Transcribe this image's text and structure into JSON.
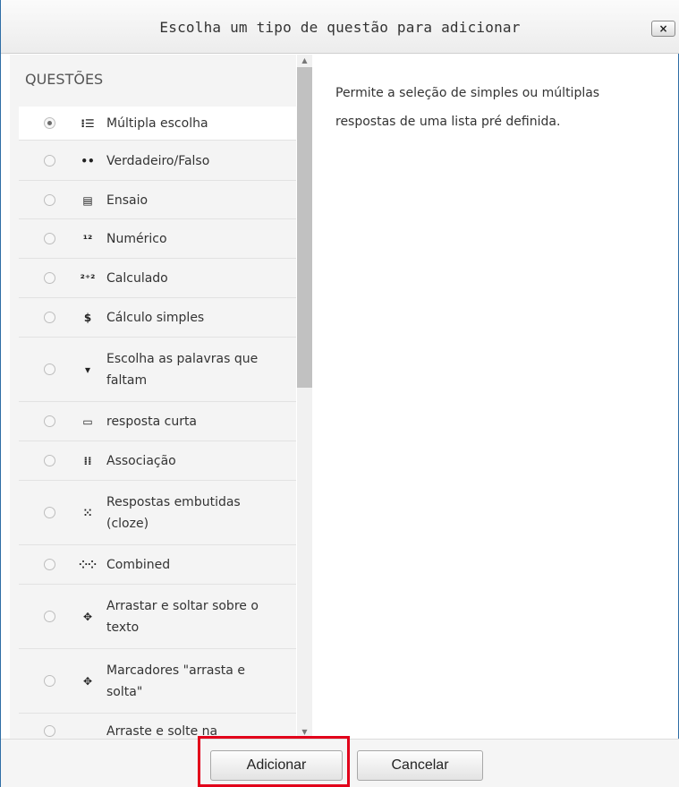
{
  "dialog": {
    "title": "Escolha um tipo de questão para adicionar",
    "close_label": "×"
  },
  "list": {
    "group_header": "QUESTÕES",
    "items": [
      {
        "label": "Múltipla escolha",
        "icon": "multiple-choice-icon",
        "glyph": "⁝☰",
        "selected": true
      },
      {
        "label": "Verdadeiro/Falso",
        "icon": "true-false-icon",
        "glyph": "••",
        "selected": false
      },
      {
        "label": "Ensaio",
        "icon": "essay-icon",
        "glyph": "▤",
        "selected": false
      },
      {
        "label": "Numérico",
        "icon": "numerical-icon",
        "glyph": "¹²",
        "selected": false
      },
      {
        "label": "Calculado",
        "icon": "calculated-icon",
        "glyph": "²⁺²",
        "selected": false
      },
      {
        "label": "Cálculo simples",
        "icon": "calculated-simple-icon",
        "glyph": "$",
        "selected": false
      },
      {
        "label": "Escolha as palavras que faltam",
        "icon": "gapselect-icon",
        "glyph": "▾",
        "selected": false
      },
      {
        "label": "resposta curta",
        "icon": "short-answer-icon",
        "glyph": "▭",
        "selected": false
      },
      {
        "label": "Associação",
        "icon": "matching-icon",
        "glyph": "⁞⁞",
        "selected": false
      },
      {
        "label": "Respostas embutidas (cloze)",
        "icon": "cloze-icon",
        "glyph": "⁙",
        "selected": false
      },
      {
        "label": "Combined",
        "icon": "combined-icon",
        "glyph": "⁘⁘",
        "selected": false
      },
      {
        "label": "Arrastar e soltar sobre o texto",
        "icon": "ddwtos-icon",
        "glyph": "✥",
        "selected": false
      },
      {
        "label": "Marcadores \"arrasta e solta\"",
        "icon": "ddmarker-icon",
        "glyph": "✥",
        "selected": false
      },
      {
        "label": "Arraste e solte na",
        "icon": "ddimageortext-icon",
        "glyph": "",
        "selected": false
      }
    ]
  },
  "description": "Permite a seleção de simples ou múltiplas respostas de uma lista pré definida.",
  "footer": {
    "add_label": "Adicionar",
    "cancel_label": "Cancelar"
  },
  "colors": {
    "highlight": "#e2001a",
    "dialog_border": "#2f6ea6"
  }
}
